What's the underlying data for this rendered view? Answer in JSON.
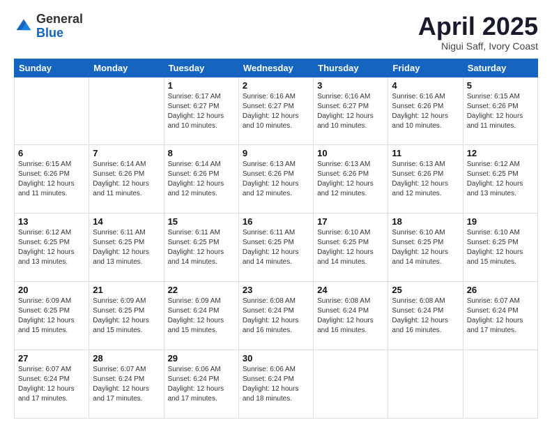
{
  "header": {
    "logo_general": "General",
    "logo_blue": "Blue",
    "title": "April 2025",
    "location": "Nigui Saff, Ivory Coast"
  },
  "days_of_week": [
    "Sunday",
    "Monday",
    "Tuesday",
    "Wednesday",
    "Thursday",
    "Friday",
    "Saturday"
  ],
  "weeks": [
    [
      {
        "day": "",
        "info": ""
      },
      {
        "day": "",
        "info": ""
      },
      {
        "day": "1",
        "info": "Sunrise: 6:17 AM\nSunset: 6:27 PM\nDaylight: 12 hours and 10 minutes."
      },
      {
        "day": "2",
        "info": "Sunrise: 6:16 AM\nSunset: 6:27 PM\nDaylight: 12 hours and 10 minutes."
      },
      {
        "day": "3",
        "info": "Sunrise: 6:16 AM\nSunset: 6:27 PM\nDaylight: 12 hours and 10 minutes."
      },
      {
        "day": "4",
        "info": "Sunrise: 6:16 AM\nSunset: 6:26 PM\nDaylight: 12 hours and 10 minutes."
      },
      {
        "day": "5",
        "info": "Sunrise: 6:15 AM\nSunset: 6:26 PM\nDaylight: 12 hours and 11 minutes."
      }
    ],
    [
      {
        "day": "6",
        "info": "Sunrise: 6:15 AM\nSunset: 6:26 PM\nDaylight: 12 hours and 11 minutes."
      },
      {
        "day": "7",
        "info": "Sunrise: 6:14 AM\nSunset: 6:26 PM\nDaylight: 12 hours and 11 minutes."
      },
      {
        "day": "8",
        "info": "Sunrise: 6:14 AM\nSunset: 6:26 PM\nDaylight: 12 hours and 12 minutes."
      },
      {
        "day": "9",
        "info": "Sunrise: 6:13 AM\nSunset: 6:26 PM\nDaylight: 12 hours and 12 minutes."
      },
      {
        "day": "10",
        "info": "Sunrise: 6:13 AM\nSunset: 6:26 PM\nDaylight: 12 hours and 12 minutes."
      },
      {
        "day": "11",
        "info": "Sunrise: 6:13 AM\nSunset: 6:26 PM\nDaylight: 12 hours and 12 minutes."
      },
      {
        "day": "12",
        "info": "Sunrise: 6:12 AM\nSunset: 6:25 PM\nDaylight: 12 hours and 13 minutes."
      }
    ],
    [
      {
        "day": "13",
        "info": "Sunrise: 6:12 AM\nSunset: 6:25 PM\nDaylight: 12 hours and 13 minutes."
      },
      {
        "day": "14",
        "info": "Sunrise: 6:11 AM\nSunset: 6:25 PM\nDaylight: 12 hours and 13 minutes."
      },
      {
        "day": "15",
        "info": "Sunrise: 6:11 AM\nSunset: 6:25 PM\nDaylight: 12 hours and 14 minutes."
      },
      {
        "day": "16",
        "info": "Sunrise: 6:11 AM\nSunset: 6:25 PM\nDaylight: 12 hours and 14 minutes."
      },
      {
        "day": "17",
        "info": "Sunrise: 6:10 AM\nSunset: 6:25 PM\nDaylight: 12 hours and 14 minutes."
      },
      {
        "day": "18",
        "info": "Sunrise: 6:10 AM\nSunset: 6:25 PM\nDaylight: 12 hours and 14 minutes."
      },
      {
        "day": "19",
        "info": "Sunrise: 6:10 AM\nSunset: 6:25 PM\nDaylight: 12 hours and 15 minutes."
      }
    ],
    [
      {
        "day": "20",
        "info": "Sunrise: 6:09 AM\nSunset: 6:25 PM\nDaylight: 12 hours and 15 minutes."
      },
      {
        "day": "21",
        "info": "Sunrise: 6:09 AM\nSunset: 6:25 PM\nDaylight: 12 hours and 15 minutes."
      },
      {
        "day": "22",
        "info": "Sunrise: 6:09 AM\nSunset: 6:24 PM\nDaylight: 12 hours and 15 minutes."
      },
      {
        "day": "23",
        "info": "Sunrise: 6:08 AM\nSunset: 6:24 PM\nDaylight: 12 hours and 16 minutes."
      },
      {
        "day": "24",
        "info": "Sunrise: 6:08 AM\nSunset: 6:24 PM\nDaylight: 12 hours and 16 minutes."
      },
      {
        "day": "25",
        "info": "Sunrise: 6:08 AM\nSunset: 6:24 PM\nDaylight: 12 hours and 16 minutes."
      },
      {
        "day": "26",
        "info": "Sunrise: 6:07 AM\nSunset: 6:24 PM\nDaylight: 12 hours and 17 minutes."
      }
    ],
    [
      {
        "day": "27",
        "info": "Sunrise: 6:07 AM\nSunset: 6:24 PM\nDaylight: 12 hours and 17 minutes."
      },
      {
        "day": "28",
        "info": "Sunrise: 6:07 AM\nSunset: 6:24 PM\nDaylight: 12 hours and 17 minutes."
      },
      {
        "day": "29",
        "info": "Sunrise: 6:06 AM\nSunset: 6:24 PM\nDaylight: 12 hours and 17 minutes."
      },
      {
        "day": "30",
        "info": "Sunrise: 6:06 AM\nSunset: 6:24 PM\nDaylight: 12 hours and 18 minutes."
      },
      {
        "day": "",
        "info": ""
      },
      {
        "day": "",
        "info": ""
      },
      {
        "day": "",
        "info": ""
      }
    ]
  ]
}
